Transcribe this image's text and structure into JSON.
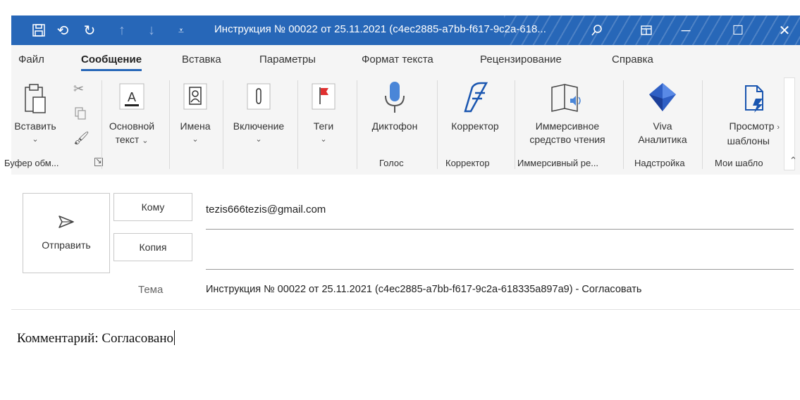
{
  "window": {
    "title": "Инструкция № 00022 от 25.11.2021 (c4ec2885-a7bb-f617-9c2a-618...",
    "accent": "#2767b8"
  },
  "menu_tabs": [
    {
      "label": "Файл"
    },
    {
      "label": "Сообщение",
      "active": true
    },
    {
      "label": "Вставка"
    },
    {
      "label": "Параметры"
    },
    {
      "label": "Формат текста"
    },
    {
      "label": "Рецензирование"
    },
    {
      "label": "Справка"
    }
  ],
  "ribbon": {
    "paste": "Вставить",
    "basic_text": [
      "Основной",
      "текст"
    ],
    "names": "Имена",
    "include": "Включение",
    "tags": "Теги",
    "dictate": "Диктофон",
    "editor": "Корректор",
    "immersive": [
      "Иммерсивное",
      "средство чтения"
    ],
    "viva": [
      "Viva",
      "Аналитика"
    ],
    "templates": [
      "Просмотр",
      "шаблоны"
    ],
    "groups": {
      "clipboard": "Буфер обм...",
      "voice": "Голос",
      "editor": "Корректор",
      "immersive": "Иммерсивный ре...",
      "addin": "Надстройка",
      "templates": "Мои шабло"
    }
  },
  "compose": {
    "send_label": "Отправить",
    "to_label": "Кому",
    "cc_label": "Копия",
    "subject_label": "Тема",
    "to_value": "tezis666tezis@gmail.com",
    "cc_value": "",
    "subject_value": "Инструкция № 00022 от 25.11.2021 (c4ec2885-a7bb-f617-9c2a-618335a897a9) - Согласовать",
    "body": "Комментарий: Согласовано"
  }
}
